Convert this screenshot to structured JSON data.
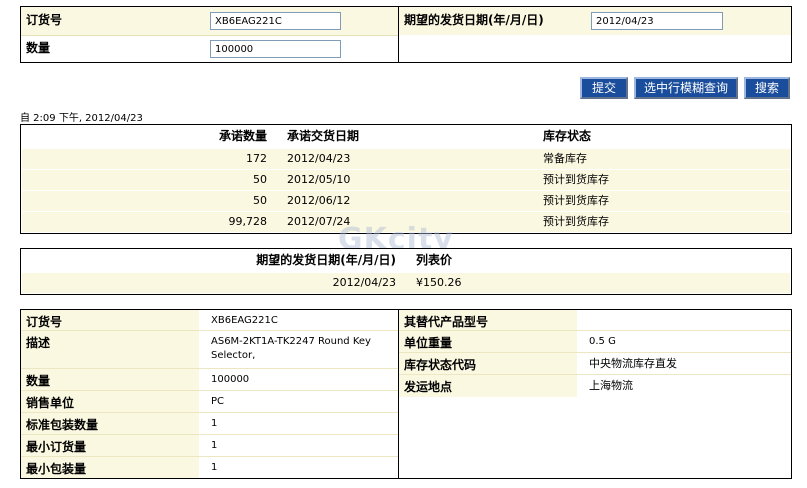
{
  "form": {
    "order_label": "订货号",
    "order_value": "XB6EAG221C",
    "qty_label": "数量",
    "qty_value": "100000",
    "date_label": "期望的发货日期(年/月/日)",
    "date_value": "2012/04/23"
  },
  "buttons": {
    "submit": "提交",
    "fuzzy_query": "选中行模糊查询",
    "search": "搜索"
  },
  "timestamp": "自 2:09 下午, 2012/04/23",
  "commitments": {
    "headers": [
      "承诺数量",
      "承诺交货日期",
      "库存状态"
    ],
    "rows": [
      {
        "qty": "172",
        "date": "2012/04/23",
        "status": "常备库存"
      },
      {
        "qty": "50",
        "date": "2012/05/10",
        "status": "预计到货库存"
      },
      {
        "qty": "50",
        "date": "2012/06/12",
        "status": "预计到货库存"
      },
      {
        "qty": "99,728",
        "date": "2012/07/24",
        "status": "预计到货库存"
      }
    ]
  },
  "price": {
    "headers": [
      "期望的发货日期(年/月/日)",
      "列表价"
    ],
    "date": "2012/04/23",
    "list_price": "¥150.26"
  },
  "details": {
    "left": [
      {
        "label": "订货号",
        "value": "XB6EAG221C"
      },
      {
        "label": "描述",
        "value": "AS6M-2KT1A-TK2247 Round Key Selector,"
      },
      {
        "label": "数量",
        "value": "100000"
      },
      {
        "label": "销售单位",
        "value": "PC"
      },
      {
        "label": "标准包装数量",
        "value": "1"
      },
      {
        "label": "最小订货量",
        "value": "1"
      },
      {
        "label": "最小包装量",
        "value": "1"
      }
    ],
    "right": [
      {
        "label": "其替代产品型号",
        "value": ""
      },
      {
        "label": "单位重量",
        "value": "0.5 G"
      },
      {
        "label": "库存状态代码",
        "value": "中央物流库存直发"
      },
      {
        "label": "发运地点",
        "value": "上海物流"
      }
    ]
  },
  "watermark": "GKcity",
  "colors": {
    "button_bg": "#1a4d9c",
    "row_bg": "#fbf8e1",
    "input_border": "#7f9db9"
  }
}
